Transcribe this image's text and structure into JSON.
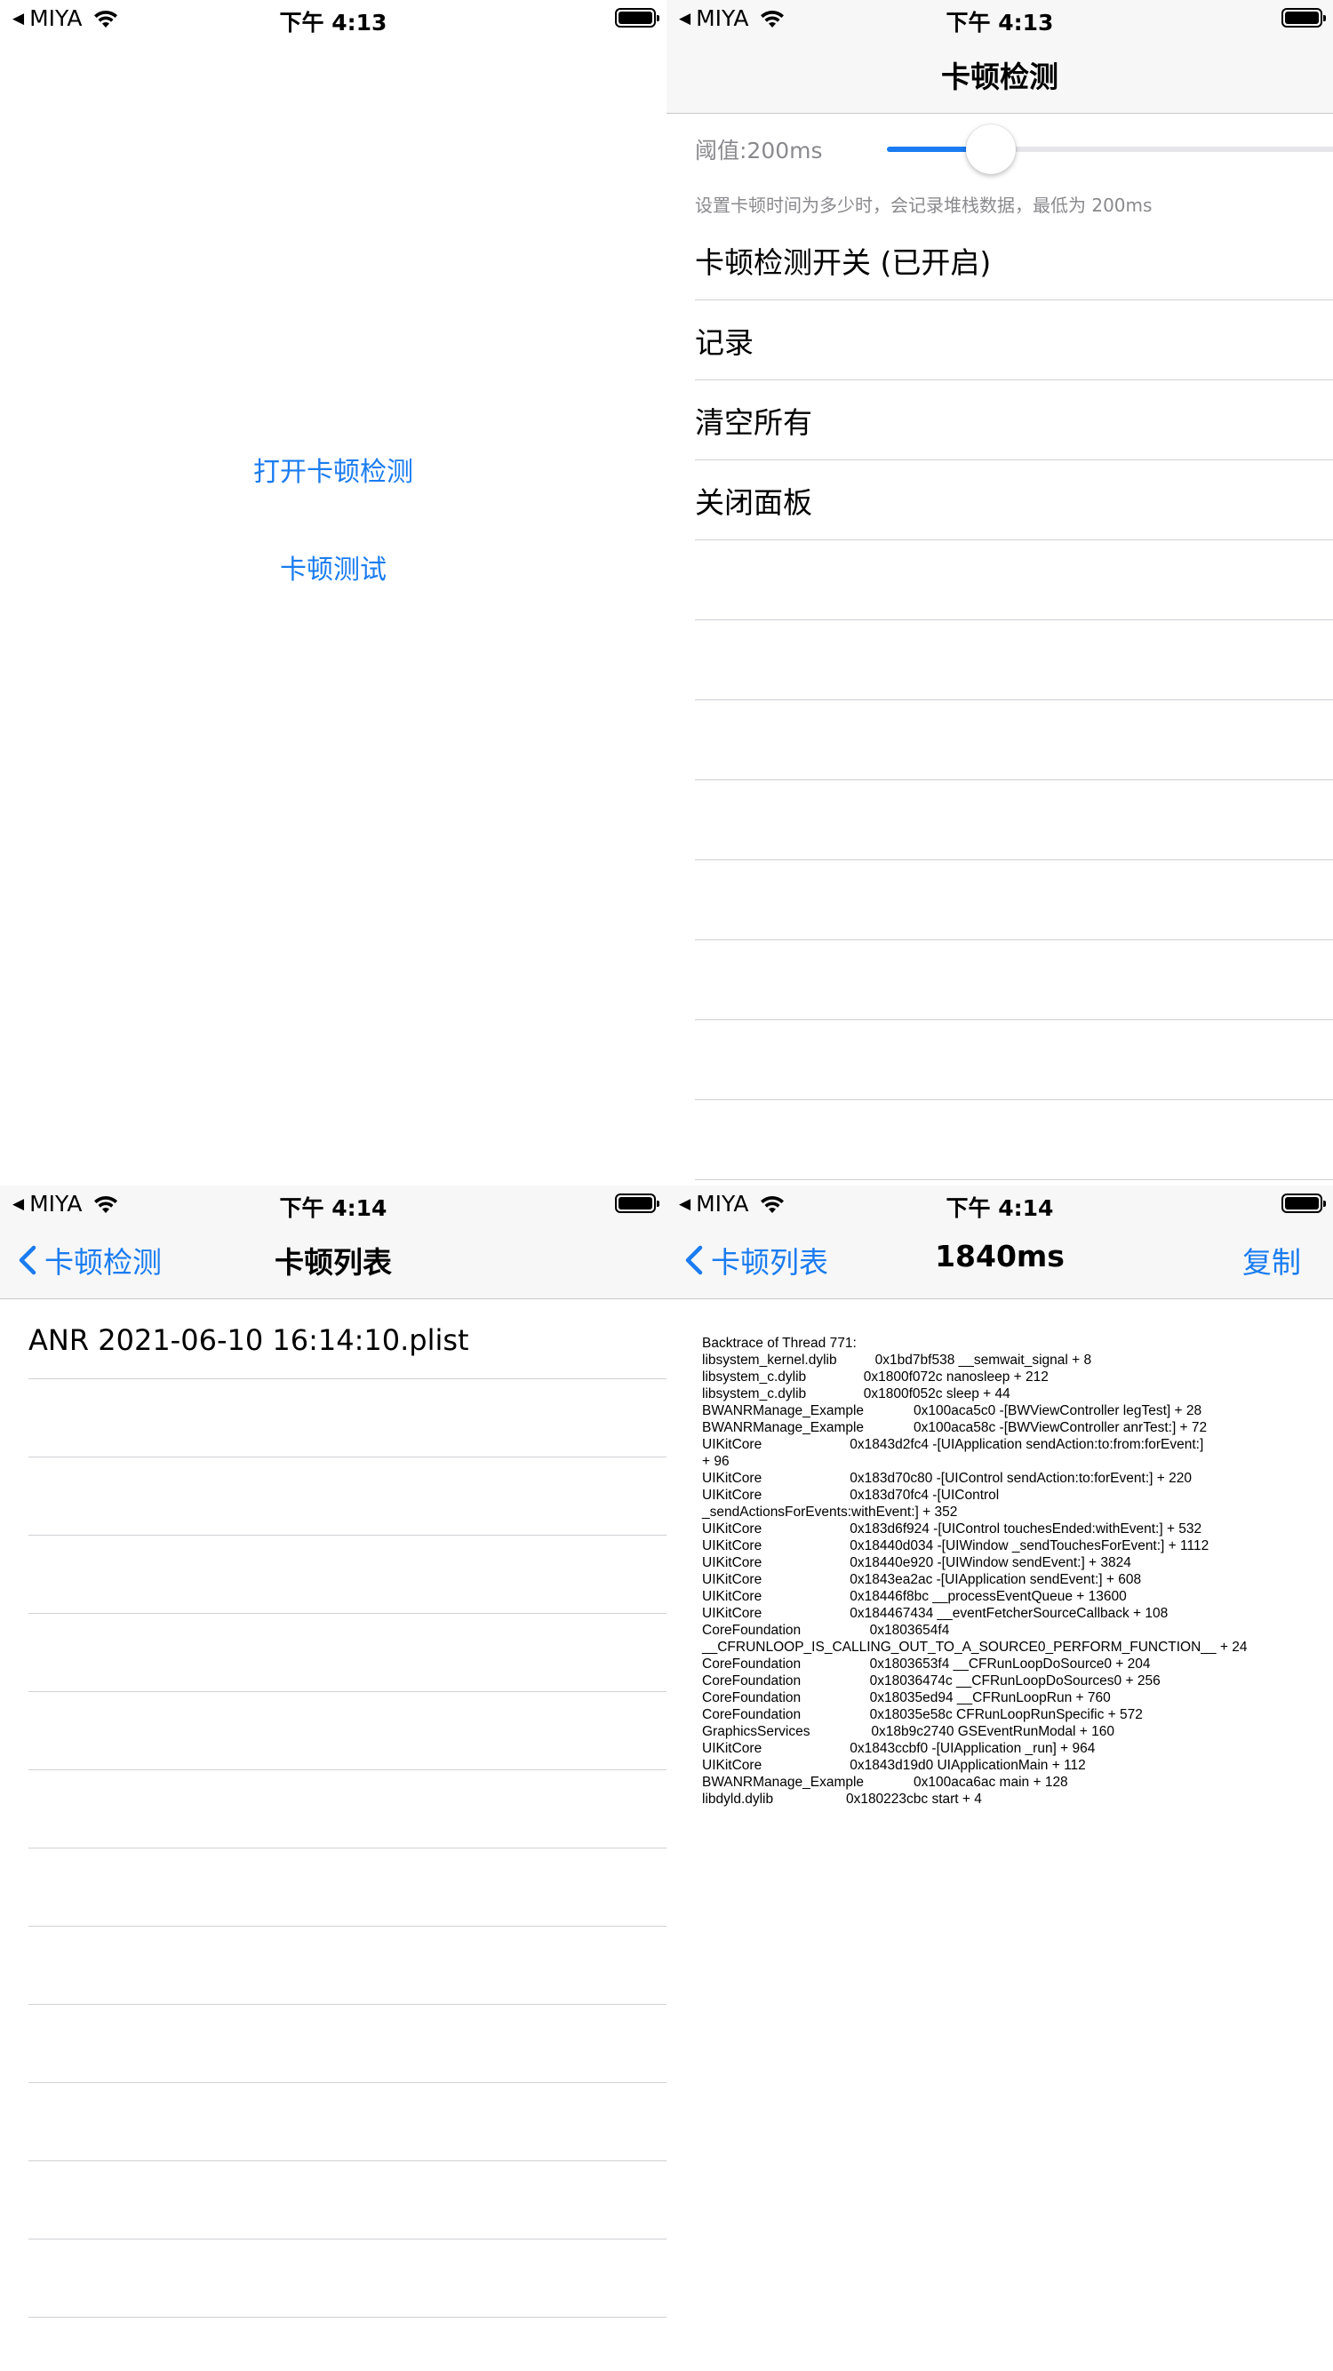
{
  "status": {
    "back_glyph": "◀",
    "carrier": "MIYA",
    "time_a": "下午 4:13",
    "time_b": "下午 4:14"
  },
  "screen1": {
    "open_button": "打开卡顿检测",
    "test_button": "卡顿测试"
  },
  "screen2": {
    "title": "卡顿检测",
    "threshold_label": "阈值:200ms",
    "slider_fraction": 0.22,
    "hint": "设置卡顿时间为多少时，会记录堆栈数据，最低为 200ms",
    "items": [
      "卡顿检测开关 (已开启)",
      "记录",
      "清空所有",
      "关闭面板"
    ]
  },
  "screen3": {
    "back_label": "卡顿检测",
    "title": "卡顿列表",
    "files": [
      "ANR 2021-06-10 16:14:10.plist"
    ]
  },
  "screen4": {
    "back_label": "卡顿列表",
    "title": "1840ms",
    "copy_label": "复制",
    "backtrace": [
      "Backtrace of Thread 771:",
      "libsystem_kernel.dylib          0x1bd7bf538 __semwait_signal + 8",
      "libsystem_c.dylib               0x1800f072c nanosleep + 212",
      "libsystem_c.dylib               0x1800f052c sleep + 44",
      "BWANRManage_Example             0x100aca5c0 -[BWViewController legTest] + 28",
      "BWANRManage_Example             0x100aca58c -[BWViewController anrTest:] + 72",
      "UIKitCore                       0x1843d2fc4 -[UIApplication sendAction:to:from:forEvent:]",
      "+ 96",
      "UIKitCore                       0x183d70c80 -[UIControl sendAction:to:forEvent:] + 220",
      "UIKitCore                       0x183d70fc4 -[UIControl",
      "_sendActionsForEvents:withEvent:] + 352",
      "UIKitCore                       0x183d6f924 -[UIControl touchesEnded:withEvent:] + 532",
      "UIKitCore                       0x18440d034 -[UIWindow _sendTouchesForEvent:] + 1112",
      "UIKitCore                       0x18440e920 -[UIWindow sendEvent:] + 3824",
      "UIKitCore                       0x1843ea2ac -[UIApplication sendEvent:] + 608",
      "UIKitCore                       0x18446f8bc __processEventQueue + 13600",
      "UIKitCore                       0x184467434 __eventFetcherSourceCallback + 108",
      "CoreFoundation                  0x1803654f4",
      "__CFRUNLOOP_IS_CALLING_OUT_TO_A_SOURCE0_PERFORM_FUNCTION__ + 24",
      "CoreFoundation                  0x1803653f4 __CFRunLoopDoSource0 + 204",
      "CoreFoundation                  0x18036474c __CFRunLoopDoSources0 + 256",
      "CoreFoundation                  0x18035ed94 __CFRunLoopRun + 760",
      "CoreFoundation                  0x18035e58c CFRunLoopRunSpecific + 572",
      "GraphicsServices                0x18b9c2740 GSEventRunModal + 160",
      "UIKitCore                       0x1843ccbf0 -[UIApplication _run] + 964",
      "UIKitCore                       0x1843d19d0 UIApplicationMain + 112",
      "BWANRManage_Example             0x100aca6ac main + 128",
      "libdyld.dylib                   0x180223cbc start + 4"
    ]
  },
  "colors": {
    "accent": "#1a7cf0",
    "separator": "#d1d1d6",
    "navbar_bg": "#f7f7f7"
  }
}
